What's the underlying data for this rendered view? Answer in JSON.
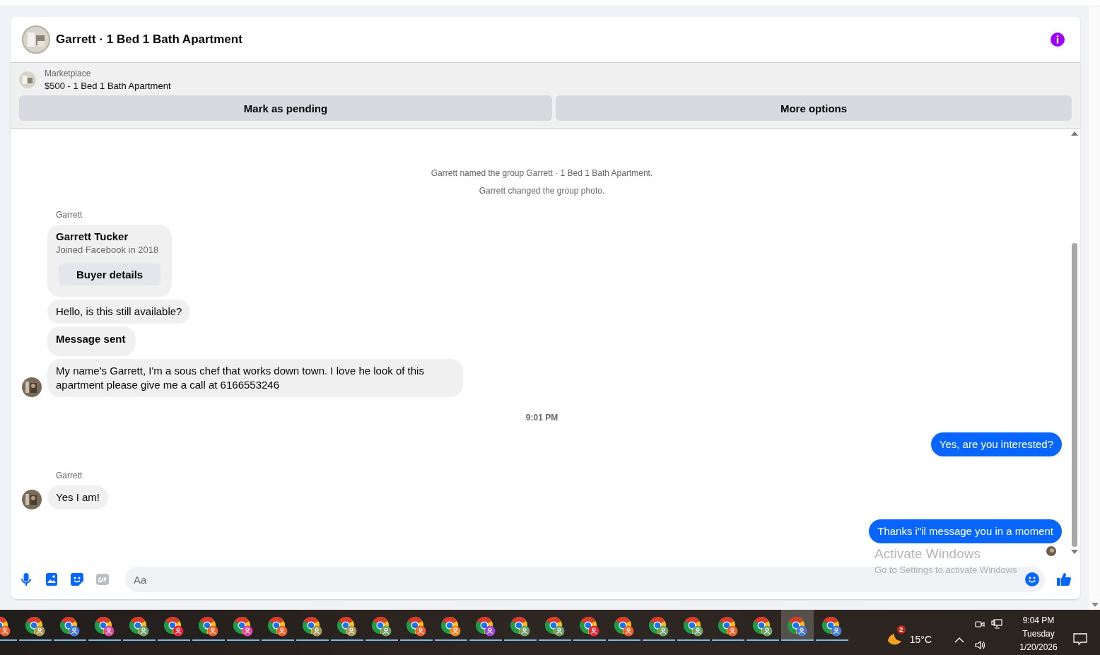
{
  "conversation": {
    "title": "Garrett · 1 Bed 1 Bath Apartment"
  },
  "listing": {
    "source": "Marketplace",
    "title": "$500 - 1 Bed 1 Bath Apartment",
    "buttons": [
      "Mark as pending",
      "More options"
    ]
  },
  "messages": [
    {
      "kind": "event",
      "text": "Garrett named the group Garrett · 1 Bed 1 Bath Apartment."
    },
    {
      "kind": "event",
      "text": "Garrett changed the group photo."
    },
    {
      "kind": "sender",
      "text": "Garrett"
    },
    {
      "kind": "profile",
      "name": "Garrett Tucker",
      "subtitle": "Joined Facebook in 2018",
      "button": "Buyer details"
    },
    {
      "kind": "incoming",
      "text": "Hello, is this still available?",
      "avatar": false
    },
    {
      "kind": "notice",
      "text": "Message sent"
    },
    {
      "kind": "incoming",
      "text": "My name's Garrett, I'm a sous chef that works down town. I love he look of this apartment please give me a call at 6166553246",
      "avatar": true
    },
    {
      "kind": "time",
      "text": "9:01 PM"
    },
    {
      "kind": "outgoing",
      "text": "Yes, are you interested?",
      "seen": false
    },
    {
      "kind": "sender",
      "text": "Garrett"
    },
    {
      "kind": "incoming",
      "text": "Yes I am!",
      "avatar": true
    },
    {
      "kind": "outgoing",
      "text": "Thanks i\"il message you in a moment",
      "seen": true
    }
  ],
  "composer": {
    "placeholder": "Aa"
  },
  "activation": {
    "title": "Activate Windows",
    "subtitle": "Go to Settings to activate Windows"
  },
  "taskbar": {
    "apps": [
      {
        "color": "#e8612c",
        "selected": false
      },
      {
        "color": "#a89a5a",
        "selected": false
      },
      {
        "color": "#4a78d0",
        "selected": false
      },
      {
        "color": "#d9479a",
        "selected": false
      },
      {
        "color": "#6fa06a",
        "selected": false
      },
      {
        "color": "#e0283a",
        "selected": false
      },
      {
        "color": "#e8612c",
        "selected": false
      },
      {
        "color": "#d9479a",
        "selected": false
      },
      {
        "color": "#e8612c",
        "selected": false
      },
      {
        "color": "#a89a5a",
        "selected": false
      },
      {
        "color": "#a89a5a",
        "selected": false
      },
      {
        "color": "#6fa06a",
        "selected": false
      },
      {
        "color": "#e8612c",
        "selected": false
      },
      {
        "color": "#e8862c",
        "selected": false
      },
      {
        "color": "#9a4ad0",
        "selected": false
      },
      {
        "color": "#6fa06a",
        "selected": false
      },
      {
        "color": "#6fa06a",
        "selected": false
      },
      {
        "color": "#e0283a",
        "selected": false
      },
      {
        "color": "#e8612c",
        "selected": false
      },
      {
        "color": "#6fa06a",
        "selected": false
      },
      {
        "color": "#6fa06a",
        "selected": false
      },
      {
        "color": "#e8612c",
        "selected": false
      },
      {
        "color": "#6fa06a",
        "selected": false
      },
      {
        "color": "#4a78d0",
        "selected": true
      },
      {
        "color": "#4a78d0",
        "selected": false
      }
    ],
    "weather": {
      "badge": "2",
      "temperature": "15°C"
    },
    "clock": {
      "time": "9:04 PM",
      "day": "Tuesday",
      "date": "1/20/2026"
    }
  }
}
